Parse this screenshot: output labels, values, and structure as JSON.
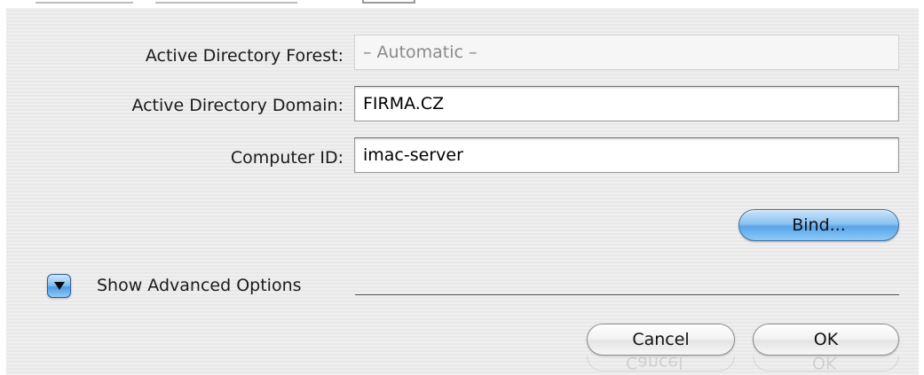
{
  "form": {
    "forest_label": "Active Directory Forest:",
    "forest_value": "– Automatic –",
    "domain_label": "Active Directory Domain:",
    "domain_value": "FIRMA.CZ",
    "computer_label": "Computer ID:",
    "computer_value": "imac-server"
  },
  "actions": {
    "bind_label": "Bind...",
    "advanced_label": "Show Advanced Options",
    "cancel_label": "Cancel",
    "ok_label": "OK"
  },
  "icons": {
    "disclosure": "disclosure-triangle-down-icon"
  },
  "colors": {
    "accent": "#5aa5ea",
    "panel_bg": "#ececec"
  }
}
